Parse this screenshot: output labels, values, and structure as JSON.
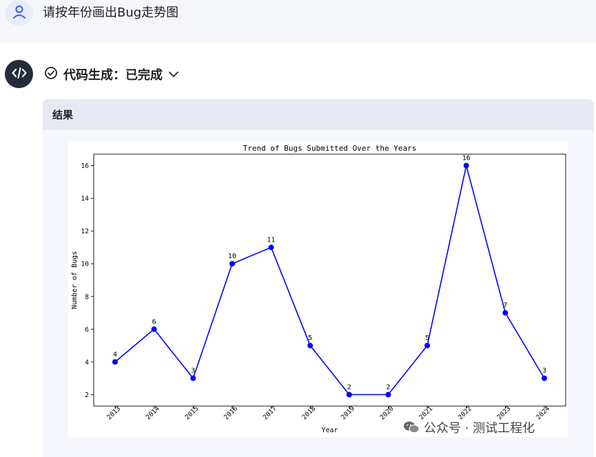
{
  "prompt": {
    "text": "请按年份画出Bug走势图"
  },
  "response": {
    "status_text": "代码生成：已完成",
    "result_title": "结果"
  },
  "icons": {
    "user": "user-icon",
    "code": "code-icon",
    "check": "check-circle-icon",
    "expand": "chevron-down-icon",
    "wechat": "wechat-icon"
  },
  "colors": {
    "line": "#0000ff",
    "avatar_bg": "#262b3b",
    "user_avatar": "#4a7cf3"
  },
  "chart_data": {
    "type": "line",
    "title": "Trend of Bugs Submitted Over the Years",
    "xlabel": "Year",
    "ylabel": "Number of Bugs",
    "x": [
      "2013",
      "2014",
      "2015",
      "2016",
      "2017",
      "2018",
      "2019",
      "2020",
      "2021",
      "2022",
      "2023",
      "2024"
    ],
    "series": [
      {
        "values": [
          4,
          6,
          3,
          10,
          11,
          5,
          2,
          2,
          5,
          16,
          7,
          3
        ]
      }
    ],
    "yticks": [
      2,
      4,
      6,
      8,
      10,
      12,
      14,
      16
    ],
    "ylim": [
      1.3,
      16.7
    ],
    "grid": false,
    "marker": "circle",
    "data_labels": true
  },
  "watermark": "公众号 · 测试工程化"
}
